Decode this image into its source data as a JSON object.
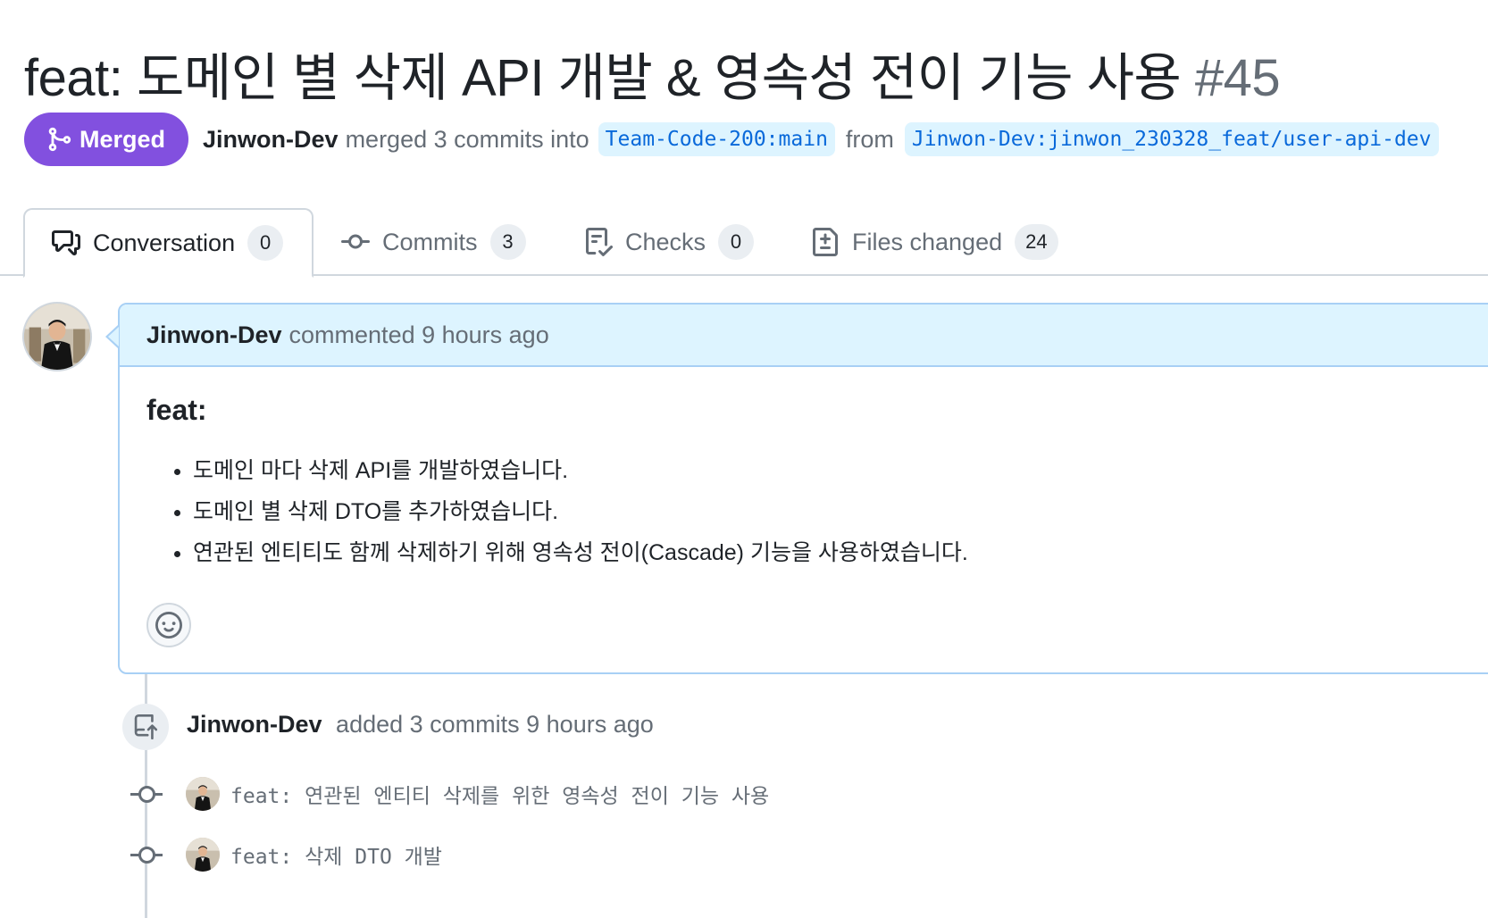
{
  "pr": {
    "title": "feat: 도메인 별 삭제 API 개발 & 영속성 전이 기능 사용",
    "number": "#45",
    "state": "Merged",
    "author": "Jinwon-Dev",
    "merge_text": "merged 3 commits into",
    "base_branch": "Team-Code-200:main",
    "from_text": "from",
    "head_branch": "Jinwon-Dev:jinwon_230328_feat/user-api-dev"
  },
  "tabs": [
    {
      "label": "Conversation",
      "count": "0",
      "icon": "comment-discussion-icon"
    },
    {
      "label": "Commits",
      "count": "3",
      "icon": "git-commit-icon"
    },
    {
      "label": "Checks",
      "count": "0",
      "icon": "checklist-icon"
    },
    {
      "label": "Files changed",
      "count": "24",
      "icon": "file-diff-icon"
    }
  ],
  "comment": {
    "author": "Jinwon-Dev",
    "meta": "commented 9 hours ago",
    "heading": "feat:",
    "items": [
      "도메인 마다 삭제 API를 개발하였습니다.",
      "도메인 별 삭제 DTO를 추가하였습니다.",
      "연관된 엔티티도 함께 삭제하기 위해 영속성 전이(Cascade) 기능을 사용하였습니다."
    ]
  },
  "event": {
    "author": "Jinwon-Dev",
    "text": "added 3 commits 9 hours ago"
  },
  "commits": [
    {
      "message": "feat: 연관된 엔티티 삭제를 위한 영속성 전이 기능 사용"
    },
    {
      "message": "feat: 삭제 DTO 개발"
    }
  ],
  "colors": {
    "merged": "#8250df",
    "link": "#0969da",
    "branch_bg": "#ddf4ff",
    "comment_header_bg": "#ddf4ff",
    "muted": "#656d76"
  }
}
